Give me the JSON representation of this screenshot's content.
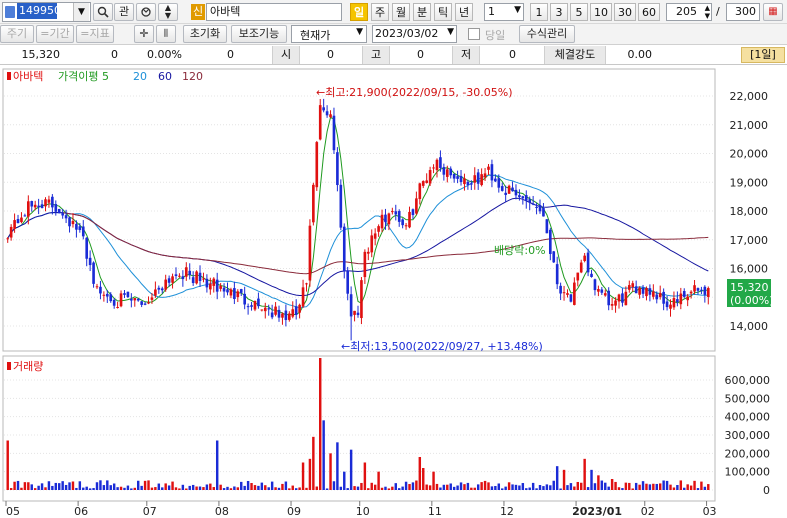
{
  "toolbar": {
    "code": "149950",
    "gwan": "관",
    "sin_badge": "신",
    "stock_name": "아바텍",
    "periods": [
      "일",
      "주",
      "월",
      "분",
      "틱",
      "년"
    ],
    "active_period": "일",
    "interval_value": "1",
    "quick_intervals": [
      "1",
      "3",
      "5",
      "10",
      "30",
      "60"
    ],
    "count_value": "205",
    "count_max": "300",
    "slash": "/"
  },
  "toolbar2": {
    "left_tabs": [
      "주기",
      "=기간",
      "=지표"
    ],
    "init_label": "초기화",
    "assist_label": "보조기능",
    "price_type": "현재가",
    "date_value": "2023/03/02",
    "same_day_label": "당일",
    "formula_label": "수식관리"
  },
  "info_bar": {
    "price": "15,320",
    "change": "0",
    "rate": "0.00%",
    "volume": "0",
    "open_label": "시",
    "open_value": "0",
    "high_label": "고",
    "high_value": "0",
    "low_label": "저",
    "low_value": "0",
    "strength_label": "체결강도",
    "strength_value": "0.00",
    "period_badge": "[1일]"
  },
  "colors": {
    "up": "#e01010",
    "down": "#1a2bd6",
    "ma5": "#209a20",
    "ma20": "#1e90d8",
    "ma60": "#1616a0",
    "ma120": "#8a2a3a",
    "accent_yellow": "#f5c400",
    "select_blue": "#2860c8"
  },
  "icons": {
    "search": "magnifier-icon",
    "refresh": "cycle-icon",
    "spin": "spin-updown-icon"
  },
  "chart_data": [
    {
      "type": "candlestick",
      "legend": [
        {
          "name": "아바텍"
        },
        {
          "name": "가격이평 5"
        },
        {
          "name": "20"
        },
        {
          "name": "60"
        },
        {
          "name": "120"
        }
      ],
      "x_labels": [
        "05",
        "06",
        "07",
        "08",
        "09",
        "10",
        "11",
        "12",
        "2023/01",
        "02",
        "03"
      ],
      "y_ticks": [
        "22,000",
        "21,000",
        "20,000",
        "19,000",
        "18,000",
        "17,000",
        "16,000",
        "15,000",
        "14,000"
      ],
      "ylim": [
        13300,
        22600
      ],
      "current_price": "15,320",
      "current_rate": "(0.00%)",
      "annotations": {
        "high": "←최고:21,900(2022/09/15, -30.05%)",
        "low": "←최저:13,500(2022/09/27, +13.48%)",
        "dividend": "배당락:0%"
      },
      "anchors": [
        [
          0,
          17300
        ],
        [
          6,
          18100
        ],
        [
          10,
          18300
        ],
        [
          16,
          18000
        ],
        [
          22,
          17000
        ],
        [
          26,
          15200
        ],
        [
          32,
          14900
        ],
        [
          40,
          14800
        ],
        [
          46,
          15600
        ],
        [
          50,
          15900
        ],
        [
          56,
          15600
        ],
        [
          62,
          15300
        ],
        [
          68,
          15000
        ],
        [
          74,
          14700
        ],
        [
          80,
          14300
        ],
        [
          84,
          14400
        ],
        [
          87,
          15500
        ],
        [
          89,
          19000
        ],
        [
          91,
          21500
        ],
        [
          94,
          21200
        ],
        [
          96,
          19000
        ],
        [
          98,
          16000
        ],
        [
          100,
          14300
        ],
        [
          102,
          14600
        ],
        [
          104,
          16600
        ],
        [
          108,
          17500
        ],
        [
          112,
          18100
        ],
        [
          116,
          17400
        ],
        [
          120,
          18800
        ],
        [
          124,
          19700
        ],
        [
          128,
          19400
        ],
        [
          132,
          19100
        ],
        [
          136,
          19000
        ],
        [
          140,
          19400
        ],
        [
          144,
          18800
        ],
        [
          148,
          18500
        ],
        [
          152,
          18400
        ],
        [
          156,
          17900
        ],
        [
          160,
          15500
        ],
        [
          164,
          15000
        ],
        [
          168,
          16300
        ],
        [
          172,
          15100
        ],
        [
          176,
          14700
        ],
        [
          180,
          15100
        ],
        [
          184,
          15400
        ],
        [
          188,
          15200
        ],
        [
          192,
          14800
        ],
        [
          196,
          14900
        ],
        [
          200,
          15200
        ],
        [
          204,
          15320
        ]
      ]
    },
    {
      "type": "bar",
      "legend": [
        {
          "name": "거래량"
        }
      ],
      "y_ticks": [
        "600,000",
        "500,000",
        "400,000",
        "300,000",
        "200,000",
        "100,000",
        "0"
      ],
      "ylim": [
        0,
        720000
      ],
      "spikes": [
        [
          0,
          270000
        ],
        [
          61,
          270000
        ],
        [
          86,
          150000
        ],
        [
          88,
          170000
        ],
        [
          89,
          290000
        ],
        [
          91,
          720000
        ],
        [
          92,
          380000
        ],
        [
          94,
          200000
        ],
        [
          96,
          260000
        ],
        [
          98,
          100000
        ],
        [
          100,
          220000
        ],
        [
          104,
          150000
        ],
        [
          108,
          100000
        ],
        [
          120,
          180000
        ],
        [
          121,
          120000
        ],
        [
          124,
          100000
        ],
        [
          160,
          130000
        ],
        [
          162,
          110000
        ],
        [
          168,
          170000
        ],
        [
          170,
          110000
        ],
        [
          172,
          80000
        ],
        [
          176,
          60000
        ],
        [
          200,
          50000
        ]
      ]
    }
  ]
}
